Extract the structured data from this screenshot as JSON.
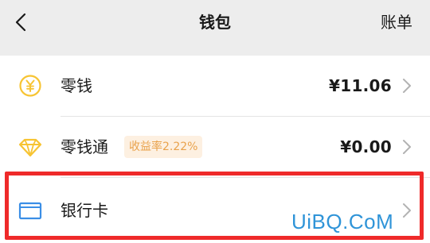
{
  "header": {
    "title": "钱包",
    "right_link": "账单",
    "back_icon": "chevron-left-icon"
  },
  "items": [
    {
      "icon": "yen-coin-icon",
      "label": "零钱",
      "amount": "¥11.06",
      "chevron_icon": "chevron-right-icon"
    },
    {
      "icon": "diamond-icon",
      "label": "零钱通",
      "badge": "收益率2.22%",
      "amount": "¥0.00",
      "chevron_icon": "chevron-right-icon"
    },
    {
      "icon": "card-icon",
      "label": "银行卡",
      "chevron_icon": "chevron-right-icon"
    }
  ],
  "watermark": "UiBQ.CoM",
  "colors": {
    "background": "#ededed",
    "accent_yellow": "#f7c433",
    "badge_bg": "#fdf0e1",
    "badge_text": "#e9a24c",
    "card_blue": "#3a8ee6",
    "highlight": "#ef2a2a",
    "watermark": "#2f94d8"
  }
}
